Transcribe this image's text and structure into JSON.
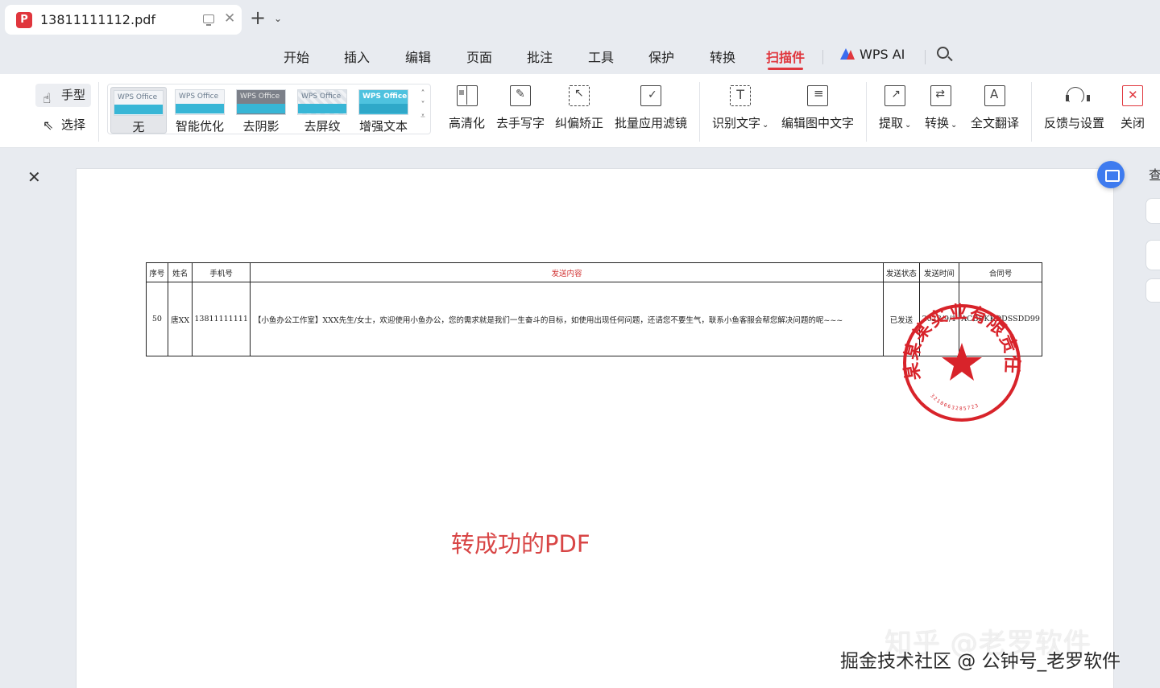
{
  "tab": {
    "title": "13811111112.pdf",
    "logo": "P",
    "close": "✕"
  },
  "new_tab": "+",
  "tab_dropdown": "⌄",
  "menu": {
    "items": [
      "开始",
      "插入",
      "编辑",
      "页面",
      "批注",
      "工具",
      "保护",
      "转换",
      "扫描件"
    ],
    "active": "扫描件",
    "wps_ai": "WPS AI"
  },
  "ribbon": {
    "hand": "手型",
    "select": "选择",
    "filters": [
      {
        "label": "无",
        "thumb": "WPS Office"
      },
      {
        "label": "智能优化",
        "thumb": "WPS Office"
      },
      {
        "label": "去阴影",
        "thumb": "WPS Office"
      },
      {
        "label": "去屏纹",
        "thumb": "WPS Office"
      },
      {
        "label": "增强文本",
        "thumb": "WPS Office"
      }
    ],
    "tools": {
      "hd": "高清化",
      "remove_handwriting": "去手写字",
      "deskew": "纠偏矫正",
      "batch_filter": "批量应用滤镜",
      "ocr": "识别文字",
      "edit_image_text": "编辑图中文字",
      "extract": "提取",
      "convert": "转换",
      "translate": "全文翻译",
      "feedback": "反馈与设置",
      "close": "关闭"
    }
  },
  "document": {
    "headers": [
      "序号",
      "姓名",
      "手机号",
      "发送内容",
      "发送状态",
      "发送时间",
      "合同号"
    ],
    "row": {
      "no": "50",
      "name": "唐XX",
      "phone": "13811111111",
      "content": "【小鱼办公工作室】XXX先生/女士，欢迎使用小鱼办公，您的需求就是我们一生奋斗的目标，如使用出现任何问题，还请您不要生气，联系小鱼客服会帮您解决问题的呢~~~",
      "status": "已发送",
      "time": "2023/9/1",
      "contract": "ACBBKKDDSSDD99"
    },
    "seal_text": "某某某实业有限责任公司",
    "seal_number": "3210063285723",
    "caption": "转成功的PDF"
  },
  "right_panel_text": "查",
  "watermarks": {
    "zhihu": "知乎 @老罗软件",
    "juejin": "掘金技术社区 @ 公钟号_老罗软件"
  },
  "colors": {
    "accent": "#e0363d",
    "seal": "#d8232a",
    "float_button": "#3e7bef"
  }
}
